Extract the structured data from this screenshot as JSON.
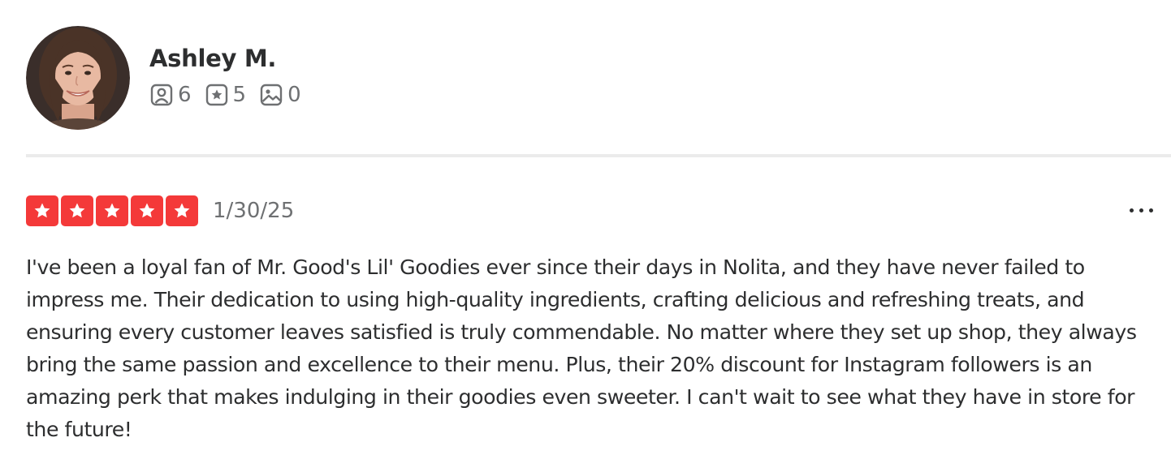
{
  "user": {
    "name": "Ashley M.",
    "avatar_icon": "user-photo",
    "stats": {
      "friends": {
        "icon": "friends-icon",
        "value": "6"
      },
      "reviews": {
        "icon": "review-star-icon",
        "value": "5"
      },
      "photos": {
        "icon": "photo-icon",
        "value": "0"
      }
    }
  },
  "review": {
    "rating": 5,
    "rating_max": 5,
    "date": "1/30/25",
    "more_icon": "more-options-icon",
    "text": "I've been a loyal fan of Mr. Good's Lil' Goodies ever since their days in Nolita, and they have never failed to impress me. Their dedication to using high-quality ingredients, crafting delicious and refreshing treats, and ensuring every customer leaves satisfied is truly commendable. No matter where they set up shop, they always bring the same passion and excellence to their menu. Plus, their 20% discount for Instagram followers is an amazing perk that makes indulging in their goodies even sweeter. I can't wait to see what they have in store for the future!"
  },
  "colors": {
    "star_red": "#f43939",
    "text_dark": "#2d2e2f",
    "text_muted": "#6e7072",
    "divider": "#ebebeb"
  }
}
